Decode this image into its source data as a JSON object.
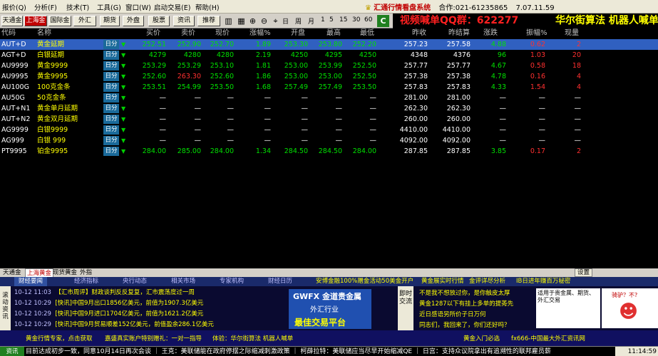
{
  "menu": {
    "items": [
      "报价(Q)",
      "分析(F)",
      "技术(T)",
      "工具(G)",
      "窗口(W)",
      "启动交易(E)",
      "帮助(H)"
    ],
    "app_title": "汇通行情看盘系统",
    "contact": "合作:021-61235865",
    "version": "7.07.11.59"
  },
  "toolbar": {
    "buttons": [
      "天通金",
      "上海金",
      "国际金",
      "外汇",
      "期货",
      "外盘",
      "股票",
      "资讯",
      "推荐"
    ],
    "periods": [
      "日",
      "周",
      "月",
      "1",
      "5",
      "15",
      "30",
      "60"
    ],
    "ad_text": "视频喊单QQ群：622277",
    "ad_text2": "华尔街算法 机器人喊单"
  },
  "table": {
    "headers": [
      "代码",
      "名称",
      "买价",
      "卖价",
      "现价",
      "涨幅%",
      "开盘",
      "最高",
      "最低",
      "昨收",
      "昨结算",
      "涨跌",
      "振幅%",
      "现量"
    ],
    "tag_label": "日分",
    "rows": [
      {
        "code": "AUT+D",
        "name": "黄金延期",
        "buy": "252.51",
        "sell": "252.90",
        "last": "252.70",
        "chg": "1.89",
        "open": "253.30",
        "high": "253.80",
        "low": "252.20",
        "prev": "257.23",
        "prevset": "257.58",
        "diff": "4.88",
        "amp": "0.62",
        "vol": "2"
      },
      {
        "code": "AGT+D",
        "name": "白银延期",
        "buy": "4279",
        "sell": "4280",
        "last": "4280",
        "chg": "2.19",
        "open": "4250",
        "high": "4295",
        "low": "4250",
        "prev": "4348",
        "prevset": "4376",
        "diff": "96",
        "amp": "1.03",
        "vol": "20"
      },
      {
        "code": "AU9999",
        "name": "黄金9999",
        "buy": "253.29",
        "sell": "253.29",
        "last": "253.10",
        "chg": "1.81",
        "open": "253.00",
        "high": "253.99",
        "low": "252.50",
        "prev": "257.77",
        "prevset": "257.77",
        "diff": "4.67",
        "amp": "0.58",
        "vol": "18"
      },
      {
        "code": "AU9995",
        "name": "黄金9995",
        "buy": "252.60",
        "sell": "263.30",
        "last": "252.60",
        "chg": "1.86",
        "open": "253.00",
        "high": "253.00",
        "low": "252.50",
        "prev": "257.38",
        "prevset": "257.38",
        "diff": "4.78",
        "amp": "0.16",
        "vol": "4"
      },
      {
        "code": "AU100G",
        "name": "100克金条",
        "buy": "253.51",
        "sell": "254.99",
        "last": "253.50",
        "chg": "1.68",
        "open": "257.49",
        "high": "257.49",
        "low": "253.50",
        "prev": "257.83",
        "prevset": "257.83",
        "diff": "4.33",
        "amp": "1.54",
        "vol": "4"
      },
      {
        "code": "AU50G",
        "name": "50克金条",
        "buy": "—",
        "sell": "—",
        "last": "—",
        "chg": "—",
        "open": "—",
        "high": "—",
        "low": "—",
        "prev": "281.00",
        "prevset": "281.00",
        "diff": "—",
        "amp": "—",
        "vol": "—"
      },
      {
        "code": "AUT+N1",
        "name": "黄金单月延期",
        "buy": "—",
        "sell": "—",
        "last": "—",
        "chg": "—",
        "open": "—",
        "high": "—",
        "low": "—",
        "prev": "262.30",
        "prevset": "262.30",
        "diff": "—",
        "amp": "—",
        "vol": "—"
      },
      {
        "code": "AUT+N2",
        "name": "黄金双月延期",
        "buy": "—",
        "sell": "—",
        "last": "—",
        "chg": "—",
        "open": "—",
        "high": "—",
        "low": "—",
        "prev": "260.00",
        "prevset": "260.00",
        "diff": "—",
        "amp": "—",
        "vol": "—"
      },
      {
        "code": "AG9999",
        "name": "白银9999",
        "buy": "—",
        "sell": "—",
        "last": "—",
        "chg": "—",
        "open": "—",
        "high": "—",
        "low": "—",
        "prev": "4410.00",
        "prevset": "4410.00",
        "diff": "—",
        "amp": "—",
        "vol": "—"
      },
      {
        "code": "AG999",
        "name": "白银 999",
        "buy": "—",
        "sell": "—",
        "last": "—",
        "chg": "—",
        "open": "—",
        "high": "—",
        "low": "—",
        "prev": "4092.00",
        "prevset": "4092.00",
        "diff": "—",
        "amp": "—",
        "vol": "—"
      },
      {
        "code": "PT9995",
        "name": "铂金9995",
        "buy": "284.00",
        "sell": "285.00",
        "last": "284.00",
        "chg": "1.34",
        "open": "284.50",
        "high": "284.50",
        "low": "284.00",
        "prev": "287.85",
        "prevset": "287.85",
        "diff": "3.85",
        "amp": "0.17",
        "vol": "2"
      }
    ]
  },
  "tabs": {
    "items": [
      "天通金",
      "上海黄金",
      "现货黄金",
      "外指"
    ],
    "settings": "设置"
  },
  "news_tabs": {
    "items": [
      "财经要闻",
      "经济指标",
      "央行动态",
      "相关市场",
      "专家机构",
      "财经日历"
    ],
    "hot1": "安博金融100%赠金活动50美金开户",
    "hot2": "黄金展实时行情",
    "hot3": "金评详尽分析",
    "hot4": "IB日进年赚百万秘密"
  },
  "news": {
    "side_label": "滚动资讯",
    "lines": [
      {
        "time": "10-12 11:03",
        "text": "【汇市周评】财政谈判反反复复，汇市震荡度过一周"
      },
      {
        "time": "10-12 10:29",
        "text": "[快讯]中国9月出口1856亿美元，前值为1907.3亿美元"
      },
      {
        "time": "10-12 10:29",
        "text": "[快讯]中国9月进口1704亿美元，前值为1621.2亿美元"
      },
      {
        "time": "10-12 10:29",
        "text": "[快讯]中国9月贸易顺差152亿美元，前值盈余286.1亿美元"
      }
    ],
    "banner_title": "GWFX 金道贵金属",
    "banner_sub": "外汇行业",
    "banner_main": "最佳交易平台",
    "mid_label": "即时交流",
    "right_lines": [
      "不是我不想放过你，是你触皮太厚",
      "黄金1287以下有挂上多单的提莠先",
      "近日感语另所价子日万何",
      "同志们，我回来了，你们还好吗？"
    ],
    "ad3": "适用于贵金属、期货、外汇交易",
    "ad3_q": "骑驴？不?"
  },
  "footer": {
    "links": [
      "黄金行情专家，点击获取",
      "嘉盛真实账户特别赠礼：一对一指导",
      "体验：华尔街算法 机器人喊单",
      "黄金入门必选",
      "fx666-中国最大外汇资讯网"
    ]
  },
  "status": {
    "label": "资讯",
    "ticker": "目前达成初步一致，同意10月14日再次会谈 ｜ 王克：美联储能在政府停摆之际缩减刺激政策 ｜ 柯薛拉特：美联储应当尽早开始缩减QE ｜ 日宫：支持众议院拿出有追溯性的联邦雇员薪",
    "time": "11:14:59"
  },
  "colors": {
    "accent": "#c00000",
    "grid_bg": "#000000",
    "up": "#00e000",
    "down": "#ff3030",
    "name": "#ffff00"
  }
}
